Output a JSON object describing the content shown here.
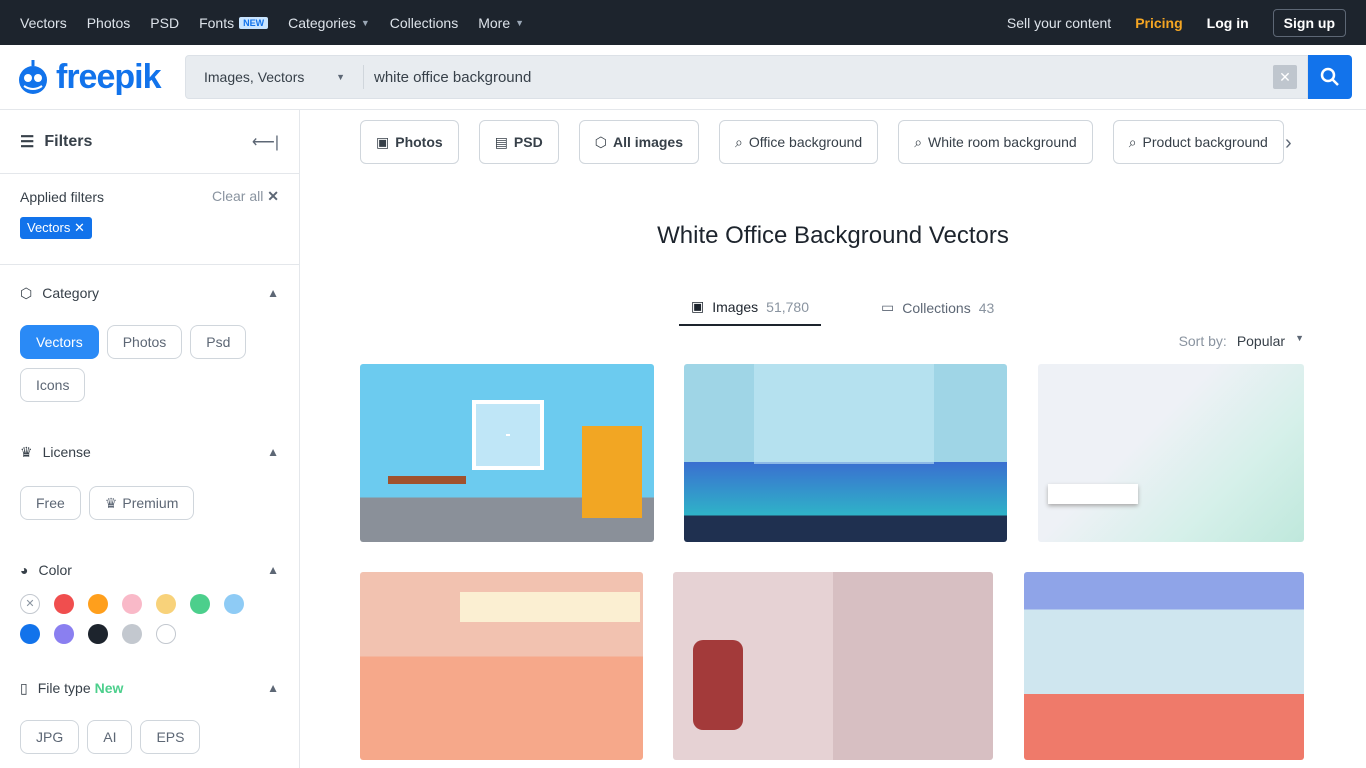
{
  "topnav": {
    "items": [
      "Vectors",
      "Photos",
      "PSD",
      "Fonts",
      "Categories",
      "Collections",
      "More"
    ],
    "fonts_badge": "NEW",
    "sell": "Sell your content",
    "pricing": "Pricing",
    "login": "Log in",
    "signup": "Sign up"
  },
  "header": {
    "logo": "freepik",
    "search_type": "Images, Vectors",
    "search_value": "white office background"
  },
  "sidebar": {
    "title": "Filters",
    "applied_label": "Applied filters",
    "clear_all": "Clear all",
    "applied": [
      "Vectors"
    ],
    "category": {
      "title": "Category",
      "options": [
        "Vectors",
        "Photos",
        "Psd",
        "Icons"
      ],
      "selected": "Vectors"
    },
    "license": {
      "title": "License",
      "options": [
        "Free",
        "Premium"
      ]
    },
    "color": {
      "title": "Color",
      "swatches": [
        "none",
        "#f04e4e",
        "#ff9f1c",
        "#f9b9c8",
        "#f8d27a",
        "#4ccf8c",
        "#8ecbf5",
        "#1273eb",
        "#8a7ff0",
        "#1d242d",
        "#c3c8cf",
        "#ffffff"
      ]
    },
    "filetype": {
      "title": "File type",
      "new": "New",
      "options": [
        "JPG",
        "AI",
        "EPS"
      ]
    }
  },
  "main": {
    "tags": [
      {
        "label": "Photos",
        "icon": "image-icon",
        "bold": true
      },
      {
        "label": "PSD",
        "icon": "psd-icon",
        "bold": true
      },
      {
        "label": "All images",
        "icon": "shapes-icon",
        "bold": true
      },
      {
        "label": "Office background",
        "icon": "search-icon"
      },
      {
        "label": "White room background",
        "icon": "search-icon"
      },
      {
        "label": "Product background",
        "icon": "search-icon"
      }
    ],
    "title": "White Office Background Vectors",
    "tabs": [
      {
        "label": "Images",
        "count": "51,780"
      },
      {
        "label": "Collections",
        "count": "43"
      }
    ],
    "sort_label": "Sort by:",
    "sort_value": "Popular"
  },
  "colors": {
    "accent": "#1273eb",
    "nav": "#1d242d",
    "pricing": "#f5a623"
  }
}
